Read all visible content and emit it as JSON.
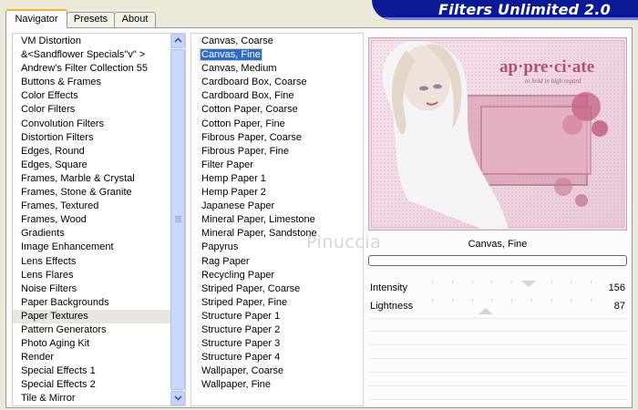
{
  "tabs": [
    {
      "label": "Navigator",
      "active": true
    },
    {
      "label": "Presets",
      "active": false
    },
    {
      "label": "About",
      "active": false
    }
  ],
  "app_title": "Filters Unlimited 2.0",
  "categories": [
    "VM Distortion",
    "&<Sandflower Specials\"v\" >",
    "Andrew's Filter Collection 55",
    "Buttons & Frames",
    "Color Effects",
    "Color Filters",
    "Convolution Filters",
    "Distortion Filters",
    "Edges, Round",
    "Edges, Square",
    "Frames, Marble & Crystal",
    "Frames, Stone & Granite",
    "Frames, Textured",
    "Frames, Wood",
    "Gradients",
    "Image Enhancement",
    "Lens Effects",
    "Lens Flares",
    "Noise Filters",
    "Paper Backgrounds",
    "Paper Textures",
    "Pattern Generators",
    "Photo Aging Kit",
    "Render",
    "Special Effects 1",
    "Special Effects 2",
    "Tile & Mirror"
  ],
  "selected_category": "Paper Textures",
  "filters": [
    "Canvas, Coarse",
    "Canvas, Fine",
    "Canvas, Medium",
    "Cardboard Box, Coarse",
    "Cardboard Box, Fine",
    "Cotton Paper, Coarse",
    "Cotton Paper, Fine",
    "Fibrous Paper, Coarse",
    "Fibrous Paper, Fine",
    "Filter Paper",
    "Hemp Paper 1",
    "Hemp Paper 2",
    "Japanese Paper",
    "Mineral Paper, Limestone",
    "Mineral Paper, Sandstone",
    "Papyrus",
    "Rag Paper",
    "Recycling Paper",
    "Striped Paper, Coarse",
    "Striped Paper, Fine",
    "Structure Paper 1",
    "Structure Paper 2",
    "Structure Paper 3",
    "Structure Paper 4",
    "Wallpaper, Coarse",
    "Wallpaper, Fine"
  ],
  "selected_filter": "Canvas, Fine",
  "preview": {
    "title_text": "ap·pre·ci·ate",
    "subtitle_text": "to hold in high regard",
    "filter_name": "Canvas, Fine"
  },
  "watermark": "Pinuccia",
  "params": [
    {
      "label": "Intensity",
      "value": "156",
      "max": 255
    },
    {
      "label": "Lightness",
      "value": "87",
      "max": 255
    }
  ],
  "colors": {
    "banner": "#0a1a96",
    "selection": "#316ac5",
    "tab_accent": "#f7b33d",
    "preview_pink": "#c9768f"
  },
  "icons": {
    "scroll_up": "chevron-up-icon",
    "scroll_down": "chevron-down-icon"
  }
}
